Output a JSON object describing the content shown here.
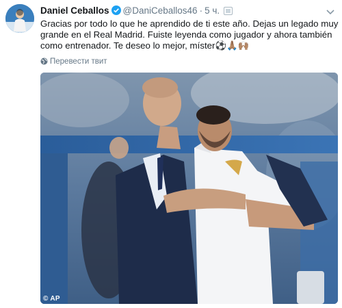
{
  "author": {
    "name": "Daniel Ceballos",
    "handle": "@DaniCeballos46",
    "separator": "·",
    "time": "5 ч.",
    "verified": true
  },
  "tweet": {
    "text": "Gracias por todo lo que he aprendido de ti este año. Dejas un legado muy grande en el Real Madrid. Fuiste leyenda como jugador y ahora también como entrenador. Te deseo lo mejor, míster",
    "emojis": "⚽🙏🏽🙌🏽"
  },
  "translate_label": "Перевести твит",
  "media": {
    "credit": "© AP"
  },
  "colors": {
    "verified": "#1da1f2",
    "muted_text": "#657786",
    "primary_text": "#14171a"
  },
  "icons": [
    "verified-icon",
    "follow-icon",
    "chevron-down-icon",
    "globe-icon"
  ]
}
